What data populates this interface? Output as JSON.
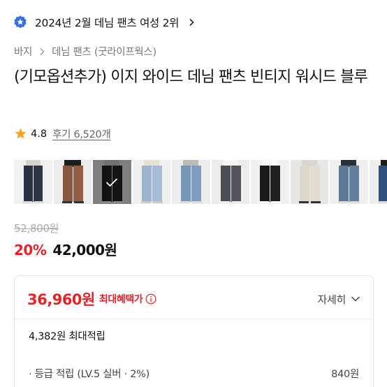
{
  "ranking": {
    "text": "2024년 2월 데님 팬츠 여성 2위",
    "badge_color": "#3b6fe0"
  },
  "breadcrumb": {
    "items": [
      "바지",
      "데님 팬츠 (굿라이프웍스)"
    ]
  },
  "product": {
    "title": "(기모옵션추가) 이지 와이드 데님 팬츠 빈티지 워시드 블루"
  },
  "rating": {
    "score": "4.8",
    "reviews": "후기 6,520개"
  },
  "thumbnails": {
    "count": 10,
    "selected_index": 2
  },
  "price": {
    "original": "52,800원",
    "discount": "20%",
    "sale": "42,000원"
  },
  "benefit": {
    "max_price": "36,960원",
    "max_label": "최대혜택가",
    "detail_label": "자세히",
    "points_line": "4,382원 최대적립",
    "grade_label": "· 등급 적립 (LV.5 실버 · 2%)",
    "grade_amount": "840원"
  },
  "colors": {
    "accent_red": "#e2242b",
    "star": "#f6a623"
  }
}
